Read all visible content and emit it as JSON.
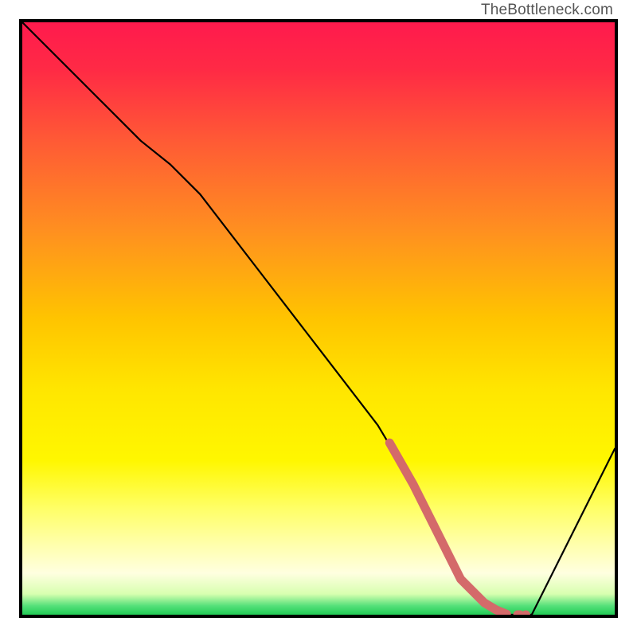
{
  "watermark": "TheBottleneck.com",
  "colors": {
    "border": "#000000",
    "curve": "#000000",
    "highlight": "#d46a6a",
    "gradient_stops": [
      {
        "offset": 0.0,
        "color": "#ff1a4d"
      },
      {
        "offset": 0.08,
        "color": "#ff2a45"
      },
      {
        "offset": 0.2,
        "color": "#ff5a35"
      },
      {
        "offset": 0.35,
        "color": "#ff8f20"
      },
      {
        "offset": 0.5,
        "color": "#ffc400"
      },
      {
        "offset": 0.62,
        "color": "#ffe600"
      },
      {
        "offset": 0.74,
        "color": "#fff700"
      },
      {
        "offset": 0.82,
        "color": "#ffff66"
      },
      {
        "offset": 0.88,
        "color": "#ffffaa"
      },
      {
        "offset": 0.93,
        "color": "#ffffe0"
      },
      {
        "offset": 0.965,
        "color": "#d8ffb0"
      },
      {
        "offset": 0.985,
        "color": "#55e07a"
      },
      {
        "offset": 1.0,
        "color": "#22cc55"
      }
    ]
  },
  "chart_data": {
    "type": "line",
    "title": "",
    "xlabel": "",
    "ylabel": "",
    "xlim": [
      0,
      100
    ],
    "ylim": [
      0,
      100
    ],
    "series": [
      {
        "name": "bottleneck-curve",
        "x": [
          0,
          10,
          20,
          25,
          30,
          40,
          50,
          60,
          66,
          70,
          74,
          78,
          82,
          86,
          100
        ],
        "y": [
          100,
          90,
          80,
          76,
          71,
          58,
          45,
          32,
          22,
          14,
          6,
          2,
          0,
          0,
          28
        ]
      }
    ],
    "highlight_segment": {
      "series": "bottleneck-curve",
      "x": [
        62,
        66,
        70,
        74,
        78,
        80,
        82,
        83,
        84,
        85
      ],
      "y": [
        29,
        22,
        14,
        6,
        2,
        0.8,
        0,
        0,
        0,
        0
      ],
      "style": "thick-dashed-tail"
    },
    "annotations": []
  }
}
